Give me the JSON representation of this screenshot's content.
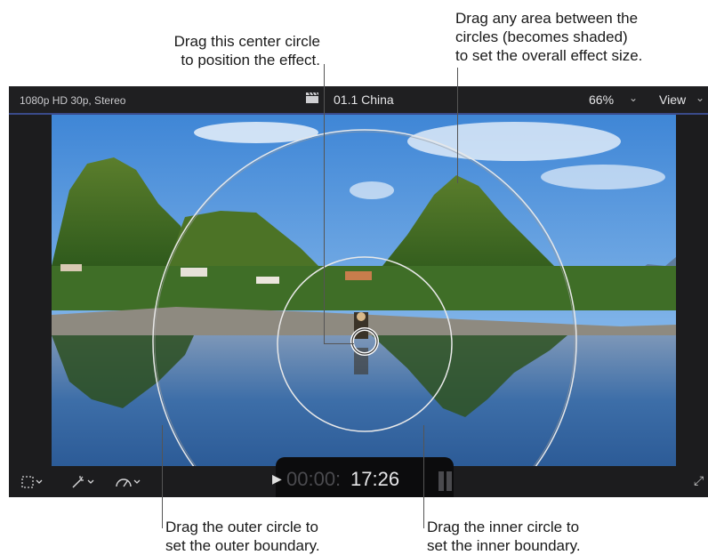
{
  "callouts": {
    "center": {
      "line1": "Drag this center circle",
      "line2": "to position the effect."
    },
    "between": {
      "line1": "Drag any area between the",
      "line2": "circles (becomes shaded)",
      "line3": "to set the overall effect size."
    },
    "outer": {
      "line1": "Drag the outer circle to",
      "line2": "set the outer boundary."
    },
    "inner": {
      "line1": "Drag the inner circle to",
      "line2": "set the inner boundary."
    }
  },
  "viewer": {
    "format": "1080p HD 30p, Stereo",
    "clip_icon": "clapperboard-icon",
    "clip_name": "01.1 China",
    "zoom": "66%",
    "zoom_chevron": "⌄",
    "view": "View",
    "view_chevron": "⌄"
  },
  "bottom": {
    "tool_icons": [
      "transform-icon",
      "magic-wand-icon",
      "speed-gauge-icon"
    ],
    "timecode_dim": "00:00:",
    "timecode": "17:26",
    "play_icon": "▶",
    "fullscreen_icon": "⤢"
  },
  "colors": {
    "accent_line": "#3a4a8a",
    "viewer_bg": "#1c1c1e"
  }
}
